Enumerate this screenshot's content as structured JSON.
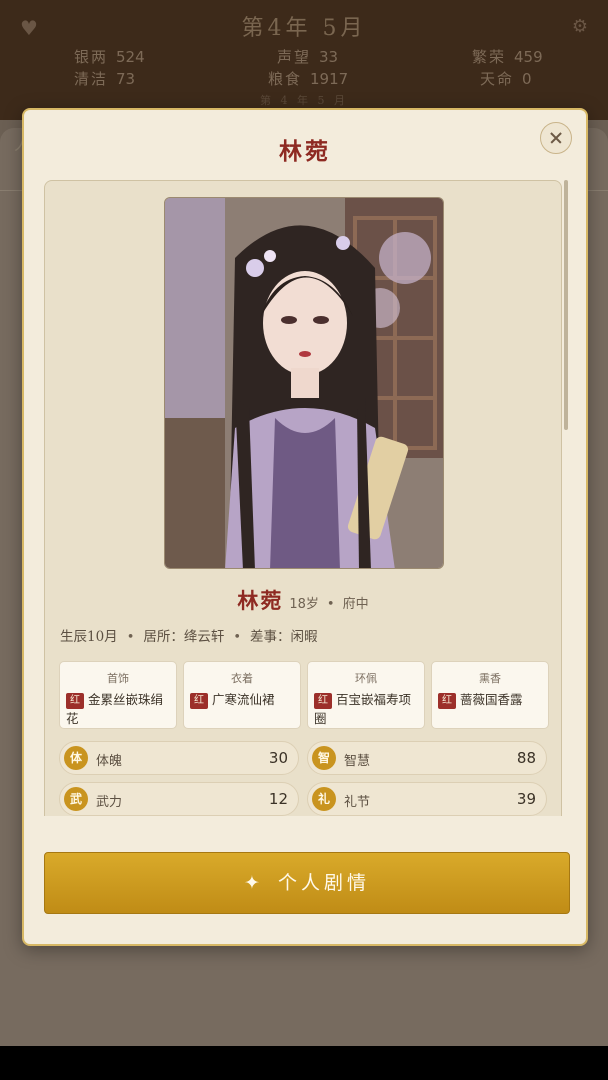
{
  "topbar": {
    "date": "第4年 5月",
    "stats": [
      {
        "label": "银两",
        "value": "524"
      },
      {
        "label": "声望",
        "value": "33"
      },
      {
        "label": "繁荣",
        "value": "459"
      },
      {
        "label": "清洁",
        "value": "73"
      },
      {
        "label": "粮食",
        "value": "1917"
      },
      {
        "label": "天命",
        "value": "0"
      }
    ],
    "sub": "第 4 年 5 月"
  },
  "background_tab": "人",
  "modal": {
    "title": "林菀",
    "character": {
      "name": "林菀",
      "age": "18岁",
      "location": "府中",
      "birth": "生辰10月",
      "residence": "居所：绛云轩",
      "duty": "差事：闲暇"
    },
    "equipment": [
      {
        "slot": "首饰",
        "grade": "红",
        "item": "金累丝嵌珠绢花"
      },
      {
        "slot": "衣着",
        "grade": "红",
        "item": "广寒流仙裙"
      },
      {
        "slot": "环佩",
        "grade": "红",
        "item": "百宝嵌福寿项圈"
      },
      {
        "slot": "熏香",
        "grade": "红",
        "item": "蔷薇国香露"
      }
    ],
    "attributes": [
      {
        "icon": "体",
        "label": "体魄",
        "value": "30"
      },
      {
        "icon": "智",
        "label": "智慧",
        "value": "88"
      },
      {
        "icon": "武",
        "label": "武力",
        "value": "12"
      },
      {
        "icon": "礼",
        "label": "礼节",
        "value": "39"
      }
    ],
    "story_button": "个人剧情",
    "story_icon": "✦",
    "grade_color": "#9c2f2a",
    "accent": "#c9941f"
  }
}
